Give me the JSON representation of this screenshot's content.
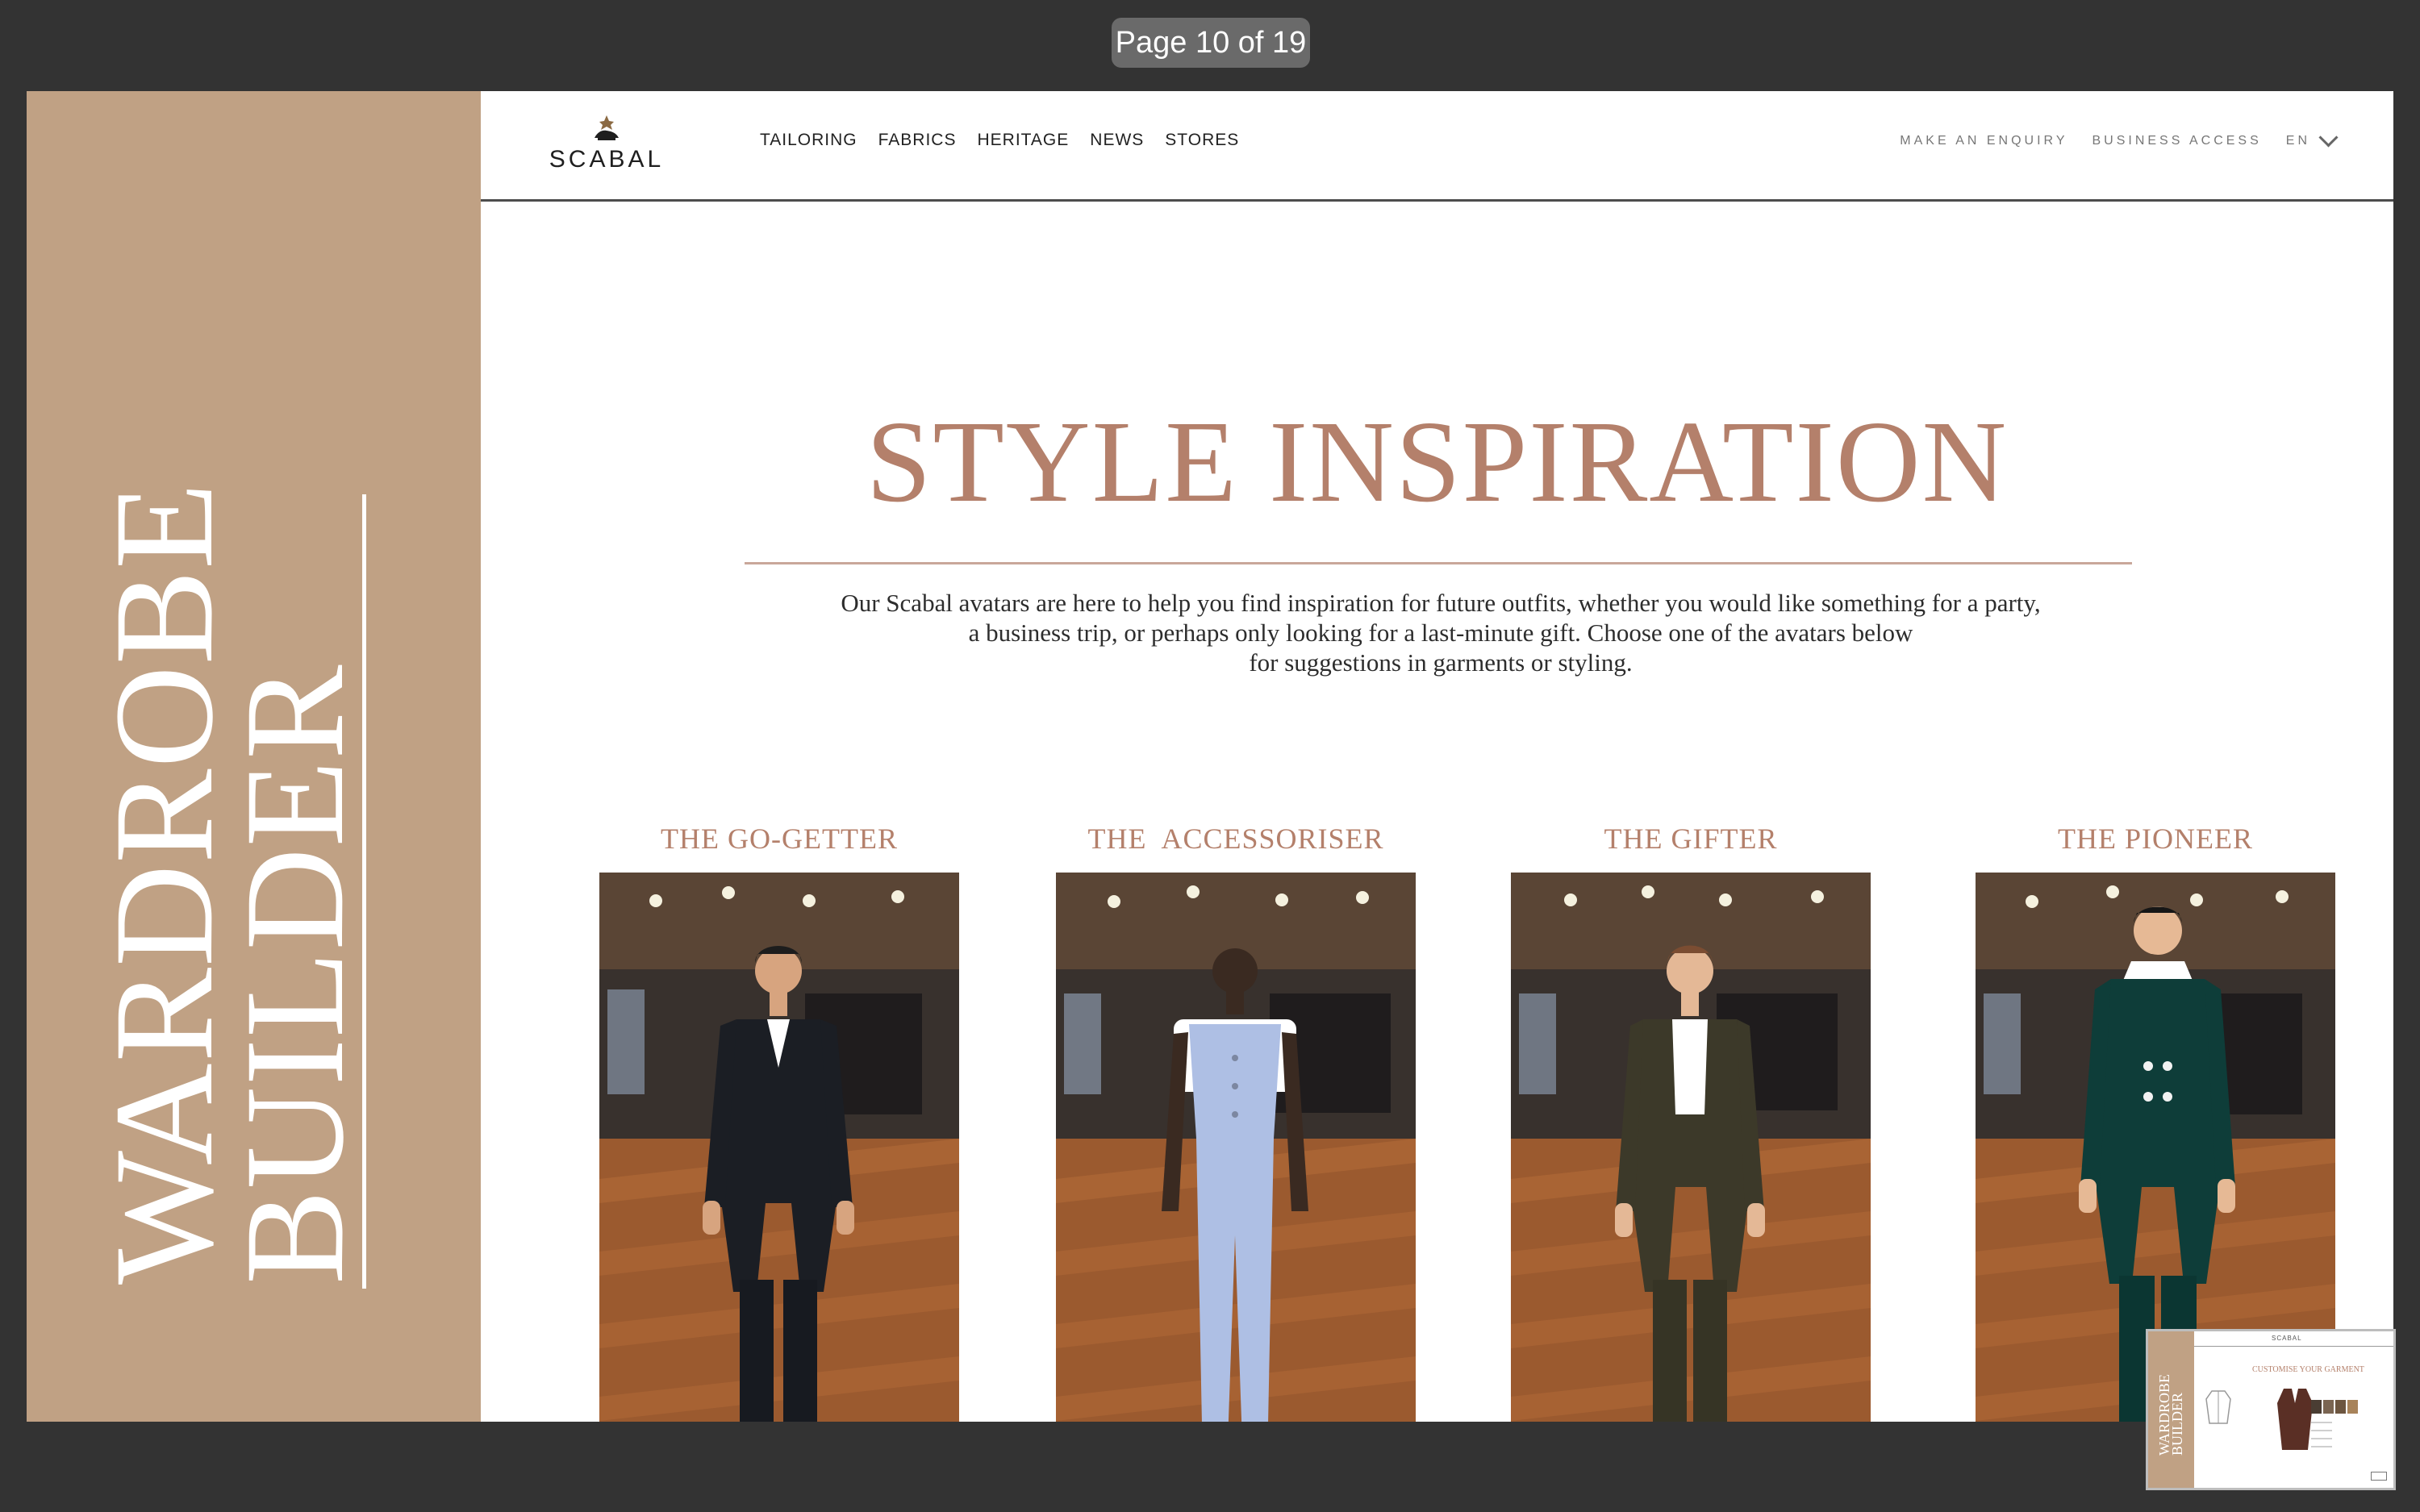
{
  "viewer": {
    "page_indicator": "Page 10 of 19"
  },
  "sidebar": {
    "title_line1": "WARDROBE",
    "title_line2": "BUILDER"
  },
  "site": {
    "logo_text": "SCABAL",
    "nav": [
      "TAILORING",
      "FABRICS",
      "HERITAGE",
      "NEWS",
      "STORES"
    ],
    "utility": {
      "enquiry": "MAKE AN ENQUIRY",
      "business": "BUSINESS ACCESS",
      "language": "EN"
    }
  },
  "hero": {
    "title": "STYLE INSPIRATION",
    "intro_lines": [
      "Our Scabal avatars are here to help you find inspiration for future outfits, whether you would like something for a party,",
      "a business trip, or perhaps only looking for a last-minute gift. Choose one of the avatars below",
      "for suggestions in garments or styling."
    ]
  },
  "avatars": [
    {
      "title": "THE GO-GETTER",
      "outfit": "black suit"
    },
    {
      "title": "THE  ACCESSORISER",
      "outfit": "light blue waistcoat and trousers"
    },
    {
      "title": "THE GIFTER",
      "outfit": "olive suit"
    },
    {
      "title": "THE PIONEER",
      "outfit": "teal double-breasted suit"
    }
  ],
  "thumbnail": {
    "side_line1": "WARDROBE",
    "side_line2": "BUILDER",
    "logo": "SCABAL",
    "heading": "CUSTOMISE YOUR GARMENT"
  },
  "colors": {
    "viewer_background": "#333333",
    "side_panel": "#C0A184",
    "accent_text": "#B4806B",
    "black_suit": "#1B1E24",
    "blue_outfit": "#AEBFE4",
    "olive_suit": "#3C3929",
    "teal_suit": "#0E3D39"
  },
  "icons": {
    "logo": "lion-crest-icon",
    "language_menu": "chevron-down-icon"
  }
}
